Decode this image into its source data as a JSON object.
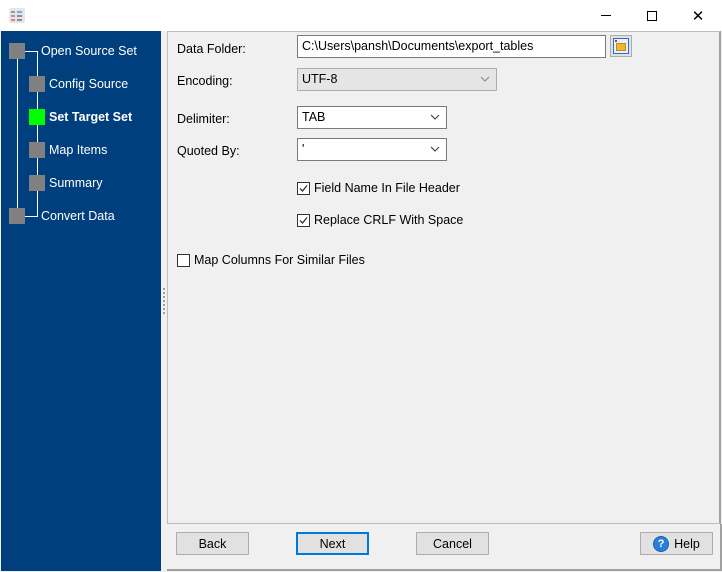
{
  "window": {
    "title": "",
    "app_icon": "app-table-icon",
    "controls": {
      "minimize": "minimize-icon",
      "maximize": "maximize-icon",
      "close": "close-icon",
      "close_glyph": "✕"
    }
  },
  "sidebar": {
    "steps": [
      {
        "label": "Open Source Set",
        "level": 0,
        "active": false
      },
      {
        "label": "Config Source",
        "level": 1,
        "active": false
      },
      {
        "label": "Set Target Set",
        "level": 1,
        "active": true
      },
      {
        "label": "Map Items",
        "level": 1,
        "active": false
      },
      {
        "label": "Summary",
        "level": 1,
        "active": false
      },
      {
        "label": "Convert Data",
        "level": 0,
        "active": false
      }
    ],
    "colors": {
      "background": "#003f7d",
      "node": "#808080",
      "active_node": "#00ff00"
    }
  },
  "form": {
    "data_folder": {
      "label": "Data Folder:",
      "value": "C:\\Users\\pansh\\Documents\\export_tables",
      "browse_icon": "folder-icon"
    },
    "encoding": {
      "label": "Encoding:",
      "value": "UTF-8",
      "enabled": false
    },
    "delimiter": {
      "label": "Delimiter:",
      "value": "TAB"
    },
    "quoted_by": {
      "label": "Quoted By:",
      "value": "'"
    },
    "field_name_in_header": {
      "label": "Field Name In File Header",
      "checked": true
    },
    "replace_crlf": {
      "label": "Replace CRLF With Space",
      "checked": true
    },
    "map_columns_similar": {
      "label": "Map Columns For Similar Files",
      "checked": false
    }
  },
  "footer": {
    "back": "Back",
    "next": "Next",
    "cancel": "Cancel",
    "help": "Help",
    "help_glyph": "?"
  }
}
